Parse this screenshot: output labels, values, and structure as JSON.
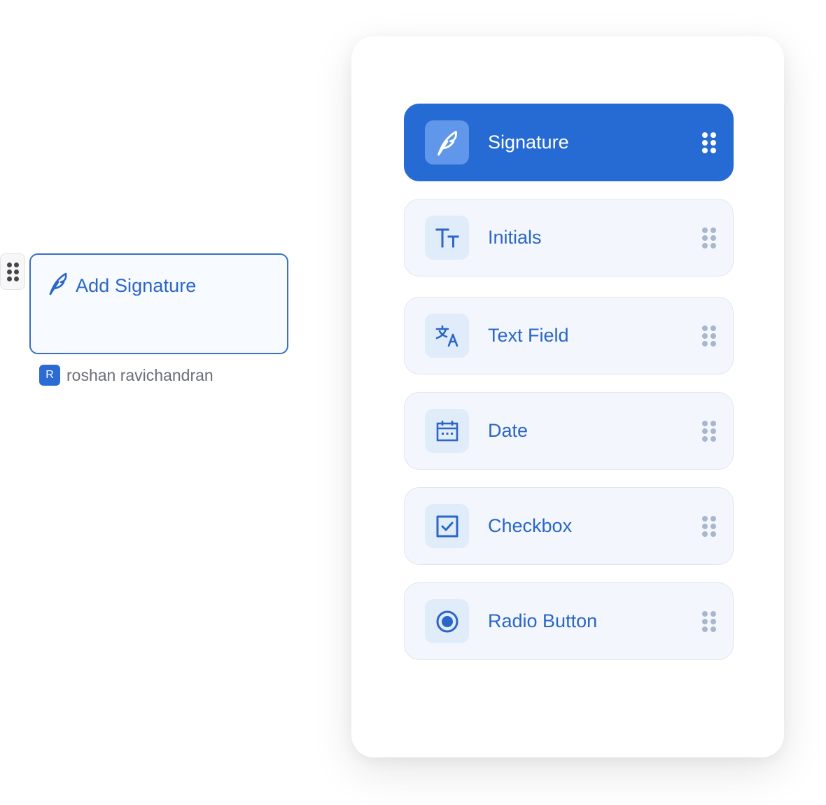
{
  "placed_field": {
    "label": "Add Signature",
    "icon": "feather-icon",
    "owner_initial": "R",
    "owner_name": "roshan ravichandran"
  },
  "colors": {
    "accent": "#266bd4",
    "accent_text": "#2a66c6",
    "item_bg": "#f3f7fd",
    "icon_bg": "#e1ecfb"
  },
  "panel": {
    "items": [
      {
        "label": "Signature",
        "icon": "feather-icon",
        "active": true
      },
      {
        "label": "Initials",
        "icon": "text-size-icon",
        "active": false
      },
      {
        "label": "Text Field",
        "icon": "translate-icon",
        "active": false
      },
      {
        "label": "Date",
        "icon": "calendar-icon",
        "active": false
      },
      {
        "label": "Checkbox",
        "icon": "checkbox-icon",
        "active": false
      },
      {
        "label": "Radio Button",
        "icon": "radio-button-icon",
        "active": false
      }
    ]
  }
}
